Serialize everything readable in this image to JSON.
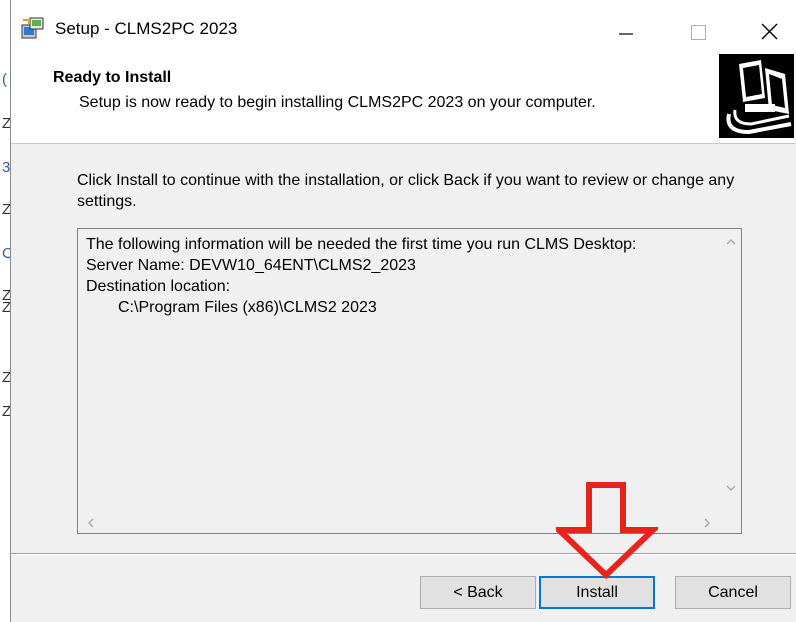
{
  "background_window": {
    "glyphs": [
      "(",
      "Z",
      "3",
      "Z",
      "C",
      "Z",
      "Z",
      "Z",
      "Z"
    ]
  },
  "titlebar": {
    "app_icon": "setup-installer-icon",
    "title": "Setup - CLMS2PC 2023",
    "minimize_icon": "minimize-icon",
    "maximize_icon": "maximize-icon",
    "close_icon": "close-icon"
  },
  "header": {
    "title": "Ready to Install",
    "subtitle": "Setup is now ready to begin installing CLMS2PC 2023 on your computer.",
    "image_icon": "computer-install-icon"
  },
  "body": {
    "instruction": "Click Install to continue with the installation, or click Back if you want to review or change any settings."
  },
  "info_box": {
    "lines": [
      "The following information will be needed the first time you run CLMS Desktop:",
      "Server Name: DEVW10_64ENT\\CLMS2_2023",
      "Destination location:",
      "C:\\Program Files (x86)\\CLMS2 2023"
    ]
  },
  "buttons": {
    "back": "< Back",
    "install": "Install",
    "cancel": "Cancel"
  },
  "annotation": {
    "arrow_icon": "red-down-arrow-icon",
    "color": "#e8231c"
  },
  "colors": {
    "focus_border": "#0078d7",
    "window_bg": "#f0f0f0"
  }
}
